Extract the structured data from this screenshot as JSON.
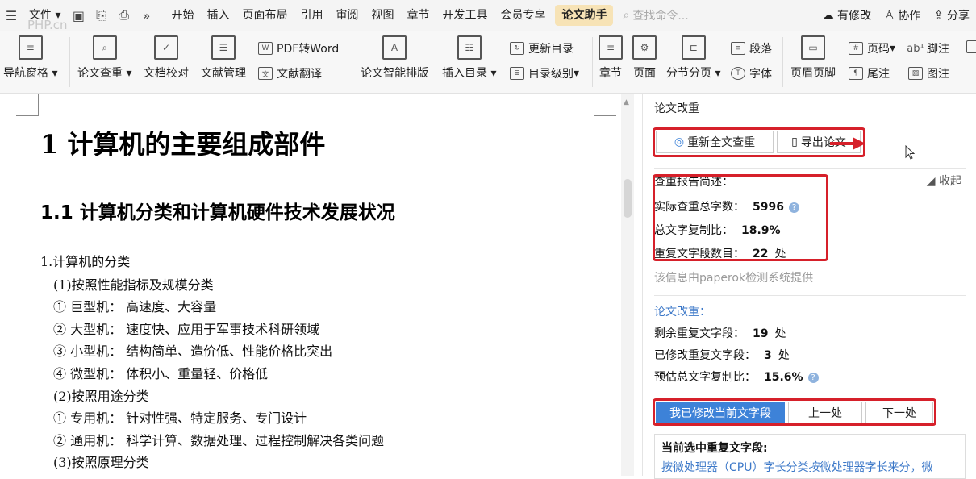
{
  "watermark": "PHP.cn",
  "menubar": {
    "file": "文件",
    "tabs": [
      "开始",
      "插入",
      "页面布局",
      "引用",
      "审阅",
      "视图",
      "章节",
      "开发工具",
      "会员专享",
      "论文助手"
    ],
    "active_tab_index": 9,
    "search_placeholder": "查找命令...",
    "right": {
      "modified": "有修改",
      "collab": "协作",
      "share": "分享"
    }
  },
  "ribbon": {
    "nav_pane": "导航窗格",
    "check": "论文查重",
    "proof": "文档校对",
    "refs": "文献管理",
    "pdf_word": "PDF转Word",
    "translate": "文献翻译",
    "smart_layout": "论文智能排版",
    "insert_toc": "插入目录",
    "update_toc": "更新目录",
    "toc_level": "目录级别",
    "chapter": "章节",
    "page": "页面",
    "section_page": "分节分页",
    "paragraph": "段落",
    "font": "字体",
    "header_footer": "页眉页脚",
    "page_number": "页码",
    "footnote": "脚注",
    "endnote": "尾注",
    "caption": "图注"
  },
  "document": {
    "h1": "1  计算机的主要组成部件",
    "h2": "1.1  计算机分类和计算机硬件技术发展状况",
    "lines": [
      "1.计算机的分类",
      "(1)按照性能指标及规模分类",
      "①  巨型机：  高速度、大容量",
      "②  大型机：  速度快、应用于军事技术科研领域",
      "③  小型机：  结构简单、造价低、性能价格比突出",
      "④  微型机：  体积小、重量轻、价格低",
      "(2)按照用途分类",
      "①  专用机：  针对性强、特定服务、专门设计",
      "②  通用机：  科学计算、数据处理、过程控制解决各类问题",
      "(3)按照原理分类"
    ]
  },
  "panel": {
    "title": "论文改重",
    "recheck_button": "重新全文查重",
    "export_button": "导出论文",
    "report_summary": "查重报告简述：",
    "collapse": "收起",
    "total_words_label": "实际查重总字数：",
    "total_words": "5996",
    "copy_ratio_label": "总文字复制比：",
    "copy_ratio": "18.9%",
    "dup_segments_label": "重复文字段数目：",
    "dup_segments": "22",
    "dup_unit": "处",
    "provider_note": "该信息由paperok检测系统提供",
    "revise_heading": "论文改重：",
    "remaining_label": "剩余重复文字段：",
    "remaining": "19",
    "modified_label": "已修改重复文字段：",
    "modified": "3",
    "est_ratio_label": "预估总文字复制比：",
    "est_ratio": "15.6%",
    "unit": "处",
    "modified_current_button": "我已修改当前文字段",
    "prev_button": "上一处",
    "next_button": "下一处",
    "current_heading": "当前选中重复文字段:",
    "current_text": "按微处理器（CPU）字长分类按微处理器字长来分，微"
  },
  "colors": {
    "highlight_red": "#d6202a",
    "primary_blue": "#3d82d8",
    "active_tab": "#f7e3b6"
  }
}
